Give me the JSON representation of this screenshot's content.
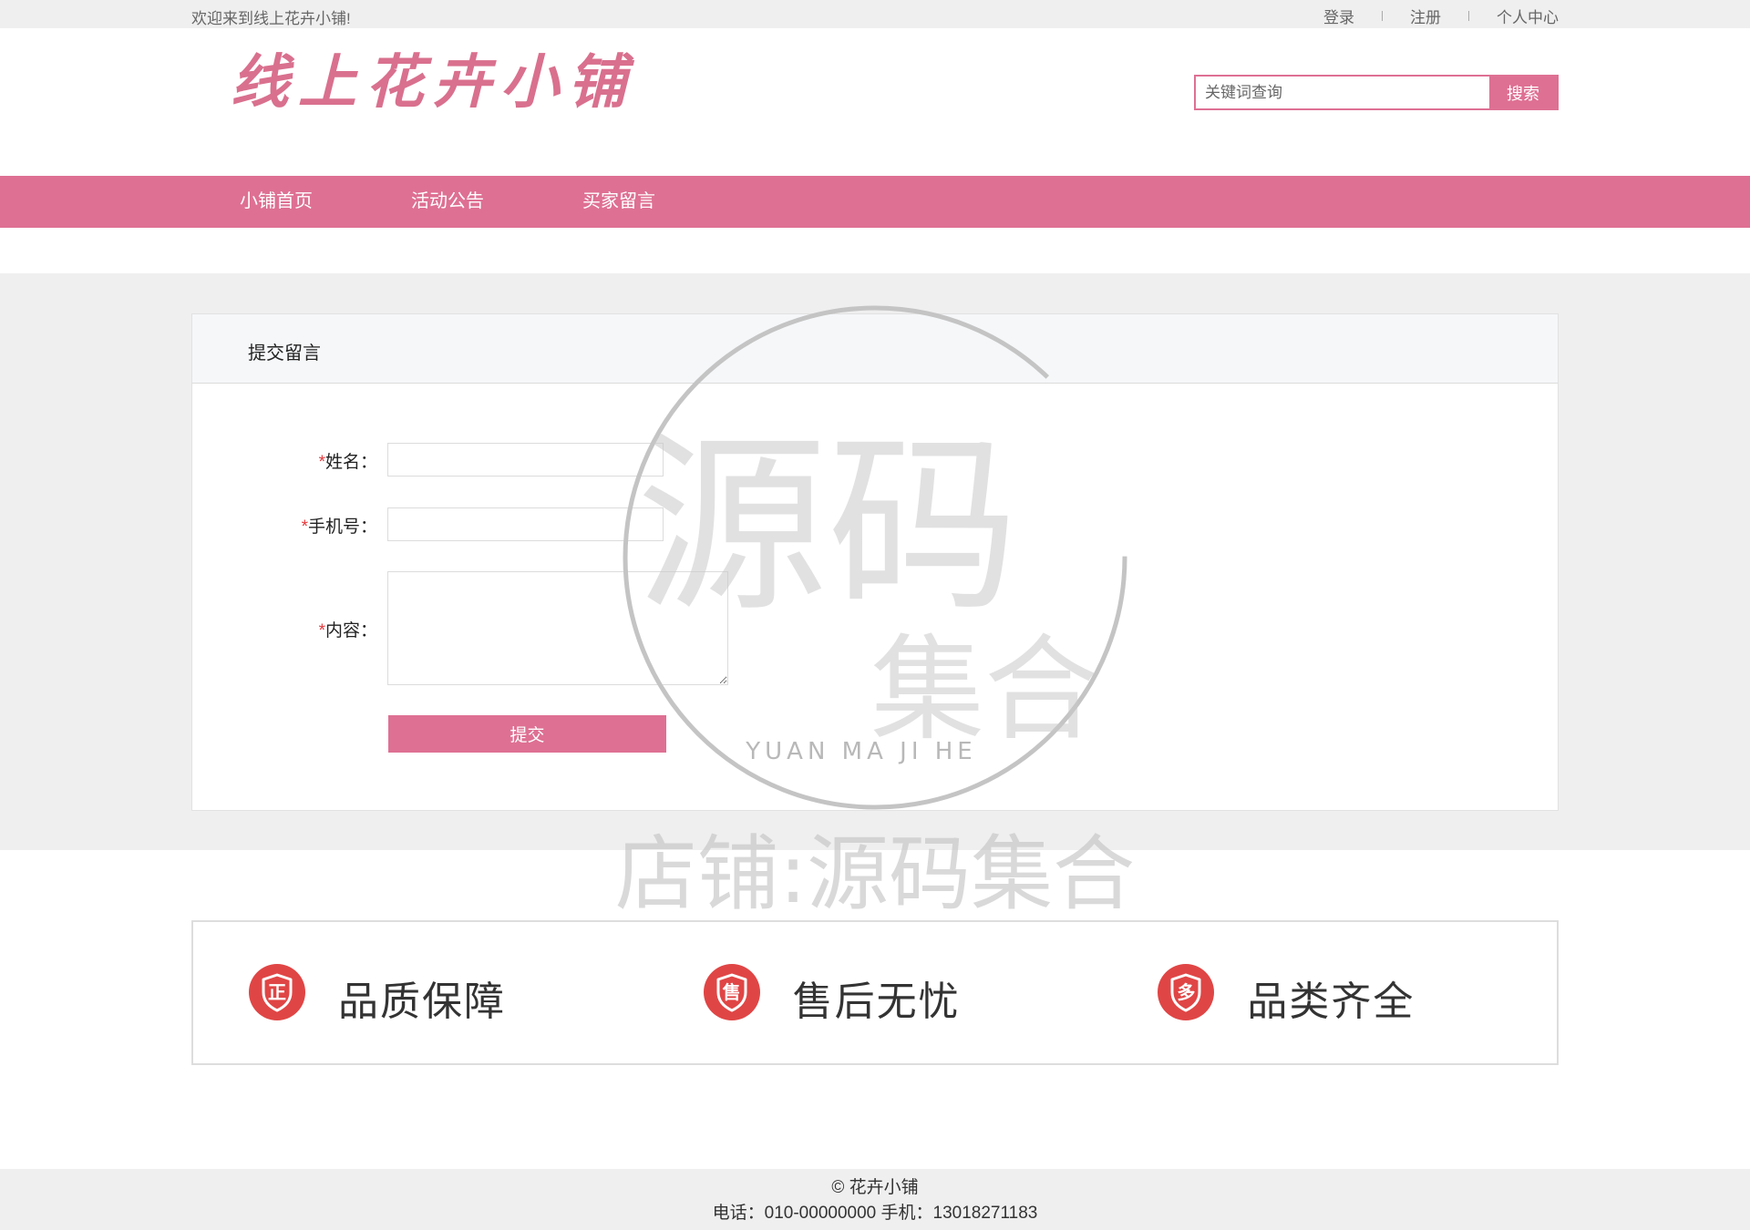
{
  "topbar": {
    "welcome": "欢迎来到线上花卉小铺!",
    "links": [
      "登录",
      "注册",
      "个人中心"
    ]
  },
  "header": {
    "logo_text": "线上花卉小铺",
    "search": {
      "placeholder": "关键词查询",
      "button": "搜索"
    }
  },
  "nav": {
    "items": [
      "小铺首页",
      "活动公告",
      "买家留言"
    ]
  },
  "form_panel": {
    "title": "提交留言",
    "fields": [
      {
        "required": "*",
        "label": "姓名：",
        "value": ""
      },
      {
        "required": "*",
        "label": "手机号：",
        "value": ""
      },
      {
        "required": "*",
        "label": "内容：",
        "value": ""
      }
    ],
    "submit": "提交"
  },
  "features": {
    "items": [
      {
        "icon": "正",
        "icon_name": "quality-guarantee-icon",
        "label": "品质保障"
      },
      {
        "icon": "售",
        "icon_name": "after-sales-icon",
        "label": "售后无忧"
      },
      {
        "icon": "多",
        "icon_name": "full-range-icon",
        "label": "品类齐全"
      }
    ]
  },
  "watermark": {
    "circle_top": "源码",
    "circle_bottom": "集合",
    "latin": "YUAN MA JI HE",
    "shop": "店铺:源码集合"
  },
  "footer": {
    "copyright": "© 花卉小铺",
    "contact": "电话：010-00000000 手机：13018271183"
  },
  "colors": {
    "accent": "#de7093",
    "icon_red": "#e04545",
    "required": "#e4393c",
    "page_gray": "#efefef"
  }
}
